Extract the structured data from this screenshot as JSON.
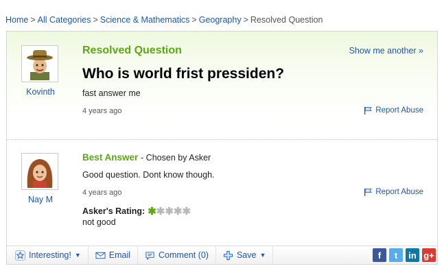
{
  "breadcrumb": {
    "items": [
      "Home",
      "All Categories",
      "Science & Mathematics",
      "Geography"
    ],
    "separator": ">",
    "current": "Resolved Question"
  },
  "question": {
    "status_label": "Resolved Question",
    "show_another": "Show me another »",
    "title": "Who is world frist pressiden?",
    "body": "fast answer me",
    "timestamp": "4 years ago",
    "report_label": "Report Abuse",
    "asker": {
      "name": "Kovinth",
      "avatar_icon": "cowboy-avatar-icon"
    }
  },
  "answer": {
    "label": "Best Answer",
    "chosen_by": "- Chosen by Asker",
    "body": "Good question. Dont know though.",
    "timestamp": "4 years ago",
    "report_label": "Report Abuse",
    "rating_label": "Asker's Rating:",
    "rating_stars": 1,
    "rating_max": 5,
    "rating_text": "not good",
    "answerer": {
      "name": "Nay M",
      "avatar_icon": "girl-avatar-icon"
    }
  },
  "toolbar": {
    "interesting": "Interesting!",
    "email": "Email",
    "comment": "Comment (0)",
    "save": "Save"
  },
  "social": {
    "facebook": "f",
    "twitter": "t",
    "linkedin": "in",
    "googleplus": "g+"
  },
  "colors": {
    "link": "#1b57b1",
    "accent_green": "#5aa815",
    "facebook": "#3b5998",
    "twitter": "#55acee",
    "linkedin": "#0e76a8",
    "googleplus": "#d73d32"
  }
}
